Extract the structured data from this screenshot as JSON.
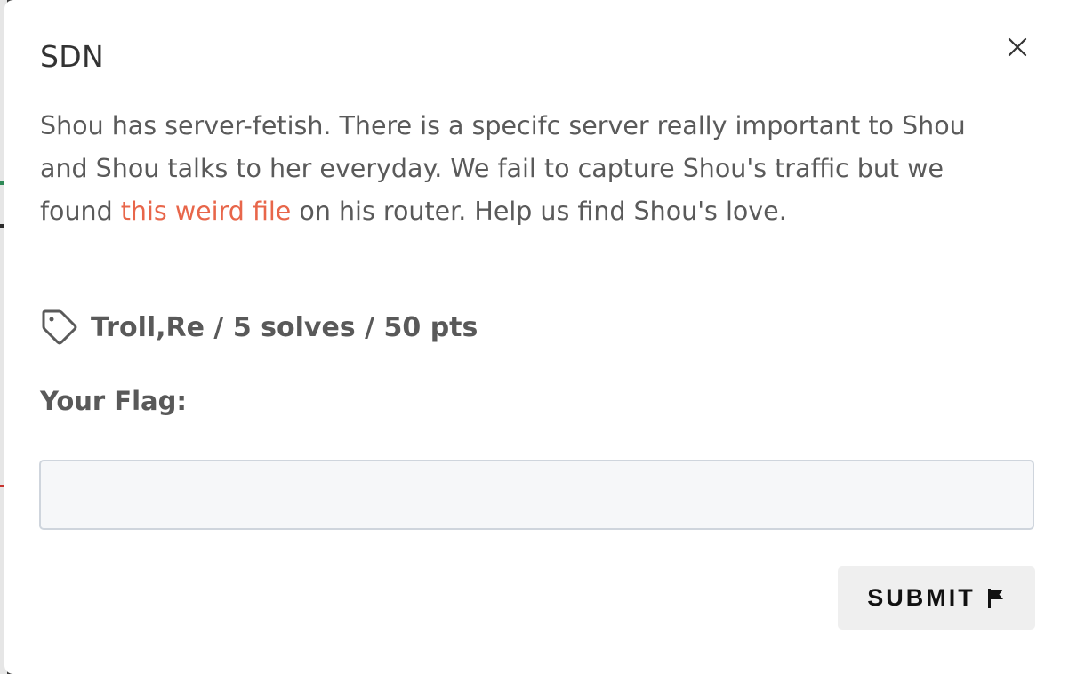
{
  "modal": {
    "title": "SDN",
    "close_icon": "close-icon",
    "description": {
      "before_link": "Shou has server-fetish. There is a specifc server really important to Shou and Shou talks to her everyday. We fail to capture Shou's traffic but we found ",
      "link_text": "this weird file",
      "after_link": " on his router. Help us find Shou's love."
    },
    "meta": {
      "icon": "tag-icon",
      "text": "Troll,Re / 5 solves / 50 pts"
    },
    "flag_label": "Your Flag:",
    "flag_input": {
      "value": "",
      "placeholder": ""
    },
    "submit": {
      "label": "SUBMIT",
      "icon": "flag-icon"
    }
  },
  "colors": {
    "link": "#e8664a",
    "text": "#5a5a5a",
    "title": "#333333",
    "input_bg": "#f6f7f9",
    "input_border": "#cfd5dd",
    "button_bg": "#efefef"
  }
}
